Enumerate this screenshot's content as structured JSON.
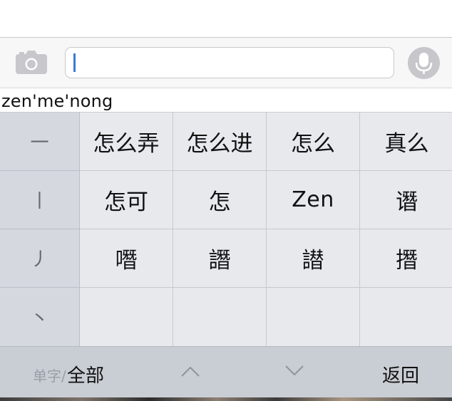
{
  "input": {
    "value": "",
    "accent": "#3c78d8"
  },
  "composition": {
    "pinyin": "zen'me'nong"
  },
  "strokes": [
    "一",
    "丨",
    "丿",
    "丶"
  ],
  "candidates": [
    "怎么弄",
    "怎么进",
    "怎么",
    "真么",
    "怎可",
    "怎",
    "Zen",
    "谮",
    "噆",
    "譖",
    "譛",
    "撍",
    "",
    "",
    "",
    ""
  ],
  "bottom": {
    "mode_single": "单字/",
    "mode_all": "全部",
    "back": "返回"
  },
  "icons": {
    "camera": "camera-icon",
    "mic": "microphone-icon",
    "page_up": "chevron-up-icon",
    "page_down": "chevron-down-icon"
  }
}
